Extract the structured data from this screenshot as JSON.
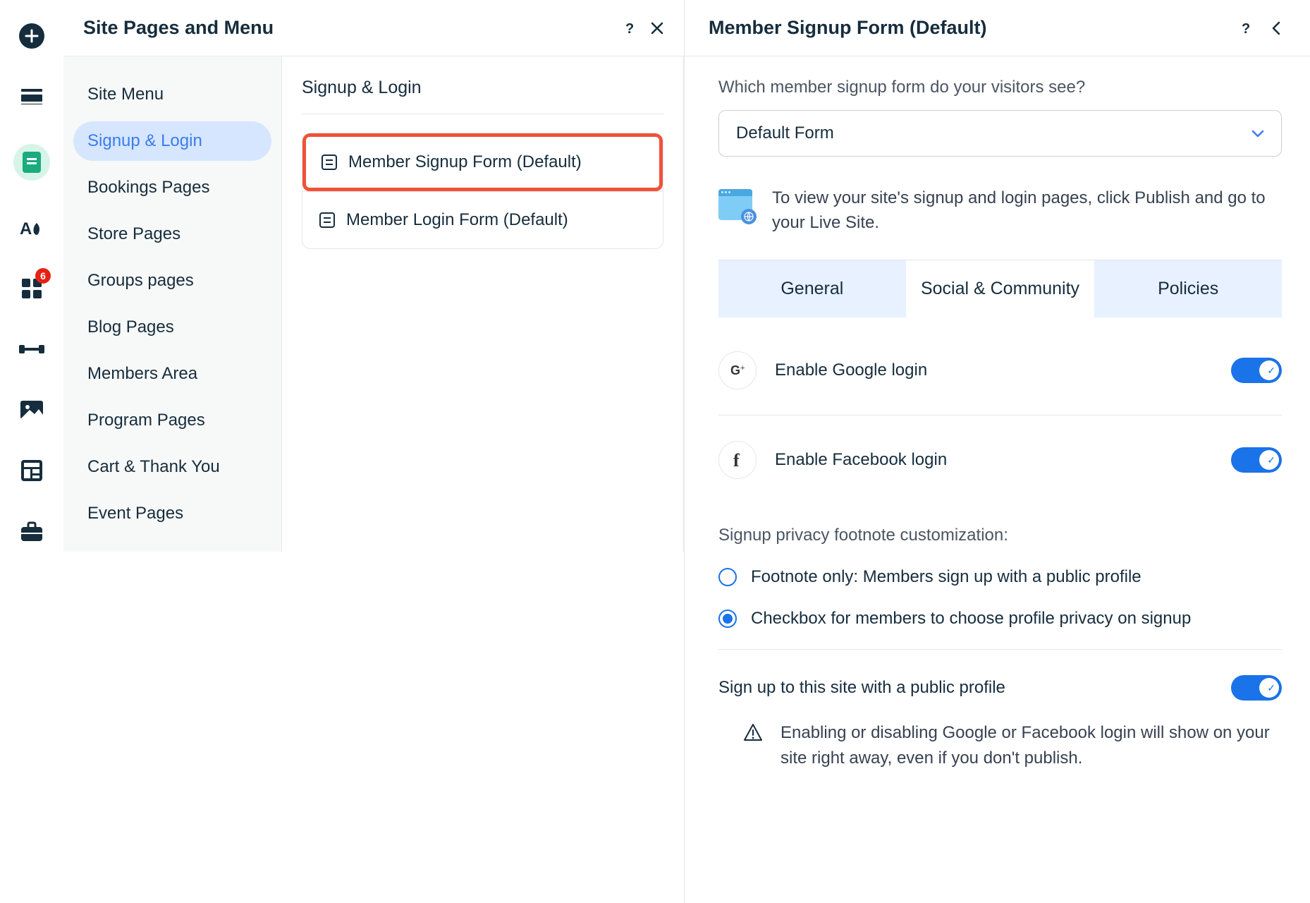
{
  "rail": {
    "badge": "6"
  },
  "header": {
    "title": "Site Pages and Menu"
  },
  "sidebar": {
    "items": [
      {
        "label": "Site Menu"
      },
      {
        "label": "Signup & Login"
      },
      {
        "label": "Bookings Pages"
      },
      {
        "label": "Store Pages"
      },
      {
        "label": "Groups pages"
      },
      {
        "label": "Blog Pages"
      },
      {
        "label": "Members Area"
      },
      {
        "label": "Program Pages"
      },
      {
        "label": "Cart & Thank You"
      },
      {
        "label": "Event Pages"
      }
    ],
    "selectedIndex": 1
  },
  "middle": {
    "title": "Signup & Login",
    "rows": [
      {
        "label": "Member Signup Form (Default)"
      },
      {
        "label": "Member Login Form (Default)"
      }
    ]
  },
  "right": {
    "title": "Member Signup Form (Default)",
    "question": "Which member signup form do your visitors see?",
    "selectValue": "Default Form",
    "infoText": "To view your site's signup and login pages, click Publish and go to your Live Site.",
    "tabs": [
      {
        "label": "General"
      },
      {
        "label": "Social & Community"
      },
      {
        "label": "Policies"
      }
    ],
    "activeTab": 1,
    "settings": {
      "google": "Enable Google login",
      "facebook": "Enable Facebook login"
    },
    "footnoteTitle": "Signup privacy footnote customization:",
    "radios": [
      "Footnote only: Members sign up with a public profile",
      "Checkbox for members to choose profile privacy on signup"
    ],
    "selectedRadio": 1,
    "publicProfile": "Sign up to this site with a public profile",
    "warning": "Enabling or disabling Google or Facebook login will show on your site right away, even if you don't publish."
  }
}
